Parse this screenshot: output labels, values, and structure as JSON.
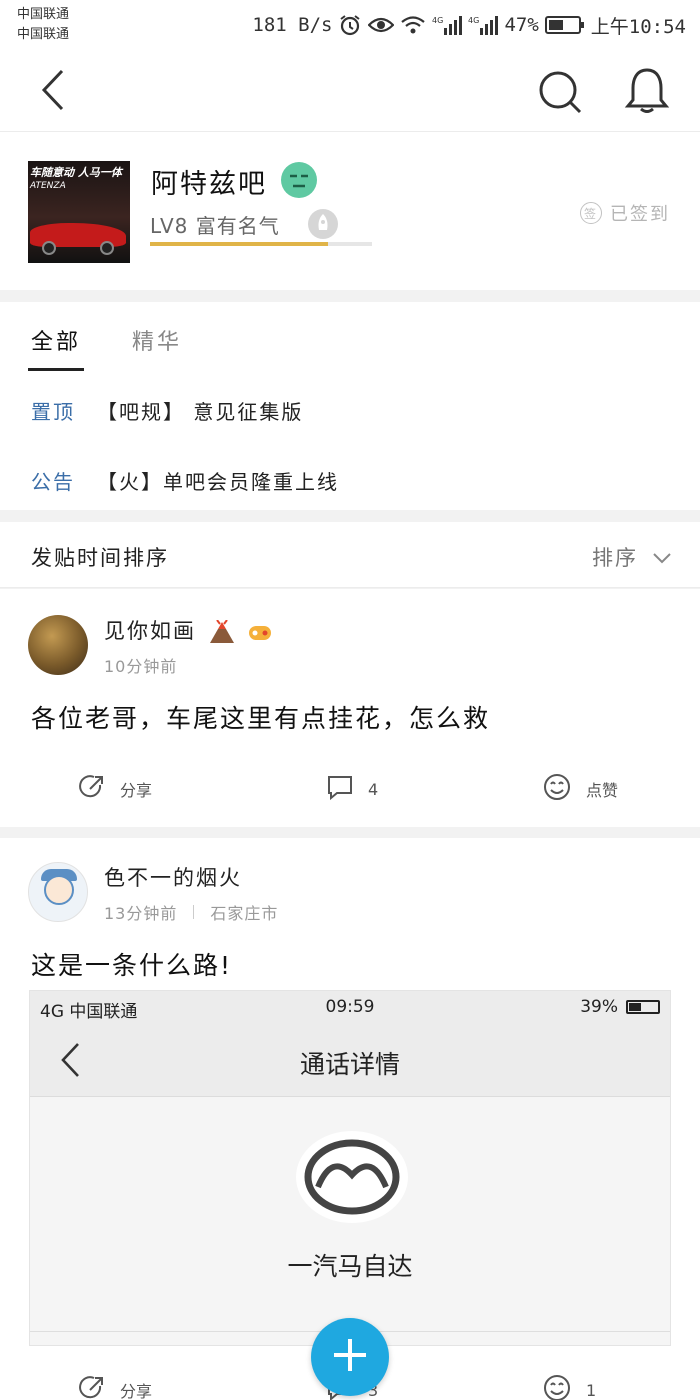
{
  "status_bar": {
    "carrier_1": "中国联通",
    "carrier_2": "中国联通",
    "net_speed": "181 B/s",
    "battery_pct": "47%",
    "time": "上午10:54",
    "signal_label": "4G"
  },
  "nav": {
    "icons": [
      "back-icon",
      "search-icon",
      "bell-icon"
    ]
  },
  "forum": {
    "name": "阿特兹吧",
    "level": "LV8 富有名气",
    "level_progress": 0.8,
    "signin_label": "已签到",
    "logo_text": "车随意动 人马一体",
    "logo_subtext": "ATENZA"
  },
  "tabs": {
    "all": "全部",
    "essence": "精华"
  },
  "pinned": [
    {
      "tag": "置顶",
      "title": "【吧规】 意见征集版"
    },
    {
      "tag": "公告",
      "title": "【火】单吧会员隆重上线"
    }
  ],
  "sort": {
    "title": "发贴时间排序",
    "button": "排序"
  },
  "posts": [
    {
      "author": "见你如画",
      "time": "10分钟前",
      "title": "各位老哥，车尾这里有点挂花，怎么救",
      "share": "分享",
      "comments": "4",
      "like": "点赞"
    },
    {
      "author": "色不一的烟火",
      "time": "13分钟前",
      "location": "石家庄市",
      "title": "这是一条什么路!",
      "share": "分享",
      "comments": "3",
      "like": "1"
    }
  ],
  "embedded_image": {
    "status_left": "4G 中国联通",
    "status_time": "09:59",
    "status_battery": "39%",
    "title": "通话详情",
    "contact": "一汽马自达"
  },
  "colors": {
    "accent_blue": "#1fa8e0",
    "pin_tag": "#3b6ea8",
    "level_bar": "#e0b448"
  }
}
